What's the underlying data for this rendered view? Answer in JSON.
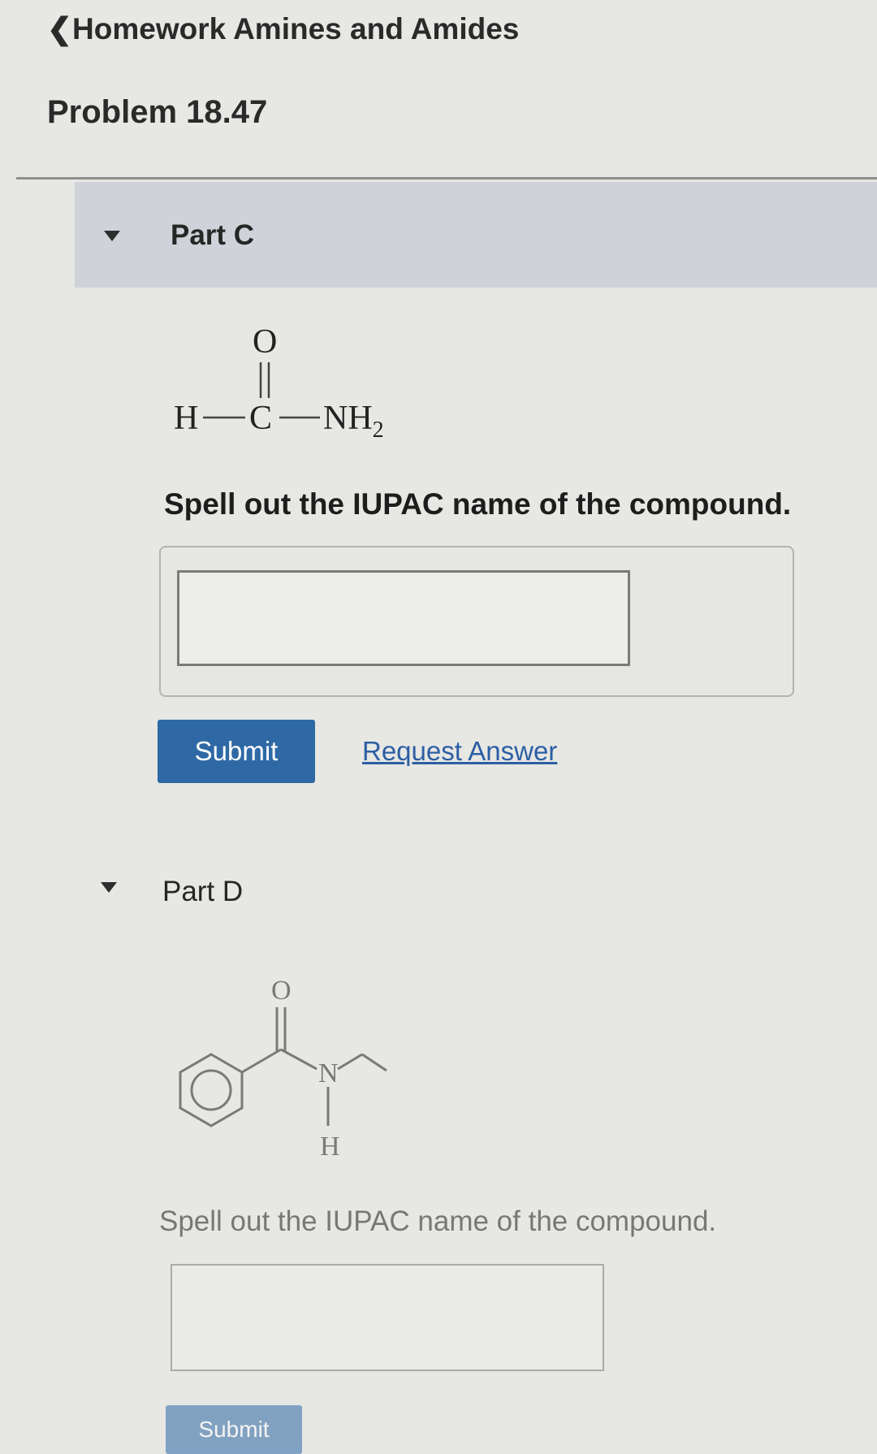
{
  "header": {
    "back_label": "Homework Amines and Amides",
    "problem_title": "Problem 18.47"
  },
  "parts": [
    {
      "title": "Part C",
      "structure": {
        "atoms": {
          "oxygen": "O",
          "hydrogen": "H",
          "carbon": "C",
          "amine": "NH",
          "amine_subscript": "2"
        }
      },
      "prompt": "Spell out the IUPAC name of the compound.",
      "answer_value": "",
      "submit_label": "Submit",
      "request_label": "Request Answer"
    },
    {
      "title": "Part D",
      "structure": {
        "atoms": {
          "oxygen": "O",
          "nitrogen": "N",
          "hydrogen": "H"
        }
      },
      "prompt": "Spell out the IUPAC name of the compound.",
      "answer_value": "",
      "submit_label": "Submit"
    }
  ],
  "colors": {
    "background": "#e7e7e4",
    "part_header": "#cfd3d9",
    "submit_button": "#2e69a5",
    "link": "#2c5fa3"
  },
  "icons": {
    "back": "chevron-left-icon",
    "collapse": "triangle-down-icon"
  }
}
